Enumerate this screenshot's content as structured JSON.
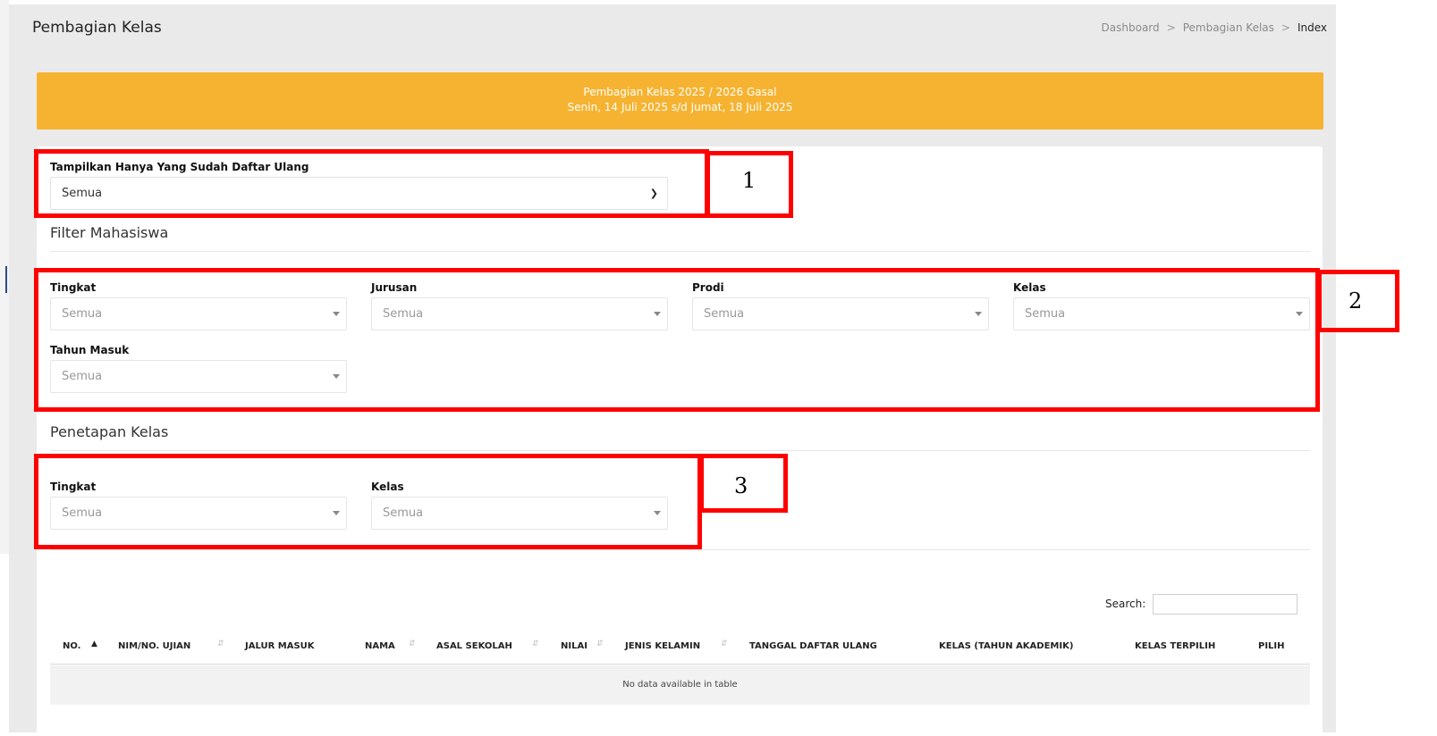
{
  "header": {
    "title": "Pembagian Kelas",
    "breadcrumb": [
      "Dashboard",
      "Pembagian Kelas",
      "Index"
    ],
    "separator": ">"
  },
  "banner": {
    "line1": "Pembagian Kelas 2025 / 2026 Gasal",
    "line2": "Senin, 14 Juli 2025 s/d Jumat, 18 Juli 2025",
    "color": "#f6b331"
  },
  "daftar_ulang": {
    "label": "Tampilkan Hanya Yang Sudah Daftar Ulang",
    "value": "Semua"
  },
  "filter_mahasiswa": {
    "title": "Filter Mahasiswa",
    "fields": [
      {
        "label": "Tingkat",
        "value": "Semua"
      },
      {
        "label": "Jurusan",
        "value": "Semua"
      },
      {
        "label": "Prodi",
        "value": "Semua"
      },
      {
        "label": "Kelas",
        "value": "Semua"
      },
      {
        "label": "Tahun Masuk",
        "value": "Semua"
      }
    ]
  },
  "penetapan_kelas": {
    "title": "Penetapan Kelas",
    "fields": [
      {
        "label": "Tingkat",
        "value": "Semua"
      },
      {
        "label": "Kelas",
        "value": "Semua"
      }
    ]
  },
  "annotations": [
    "1",
    "2",
    "3"
  ],
  "table": {
    "search_label": "Search:",
    "columns": [
      "NO.",
      "NIM/NO. UJIAN",
      "JALUR MASUK",
      "NAMA",
      "ASAL SEKOLAH",
      "NILAI",
      "JENIS KELAMIN",
      "TANGGAL DAFTAR ULANG",
      "KELAS (TAHUN AKADEMIK)",
      "KELAS TERPILIH",
      "PILIH"
    ],
    "empty_message": "No data available in table"
  },
  "colors": {
    "highlight": "#ff0000",
    "banner": "#f6b331"
  }
}
